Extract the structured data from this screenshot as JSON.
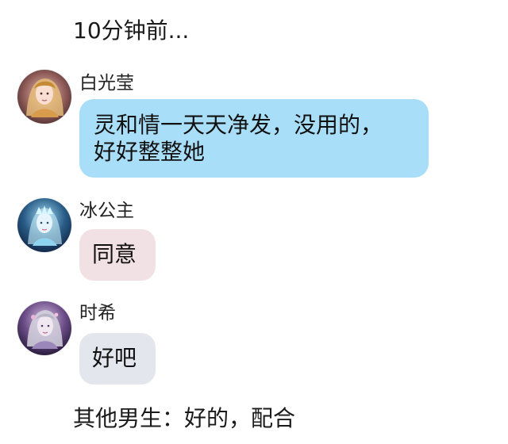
{
  "timestamp": "10分钟前...",
  "messages": [
    {
      "sender": "白光莹",
      "avatar_icon": "character-avatar-golden-hair-icon",
      "bubble_color": "#a9def8",
      "lines": [
        "灵和情一天天净发，没用的，",
        "好好整整她"
      ]
    },
    {
      "sender": "冰公主",
      "avatar_icon": "character-avatar-ice-princess-icon",
      "bubble_color": "#f2e1e4",
      "lines": [
        "同意"
      ]
    },
    {
      "sender": "时希",
      "avatar_icon": "character-avatar-silver-hair-icon",
      "bubble_color": "#e3e6ed",
      "lines": [
        "好吧"
      ]
    }
  ],
  "footer_text": "其他男生：好的，配合"
}
